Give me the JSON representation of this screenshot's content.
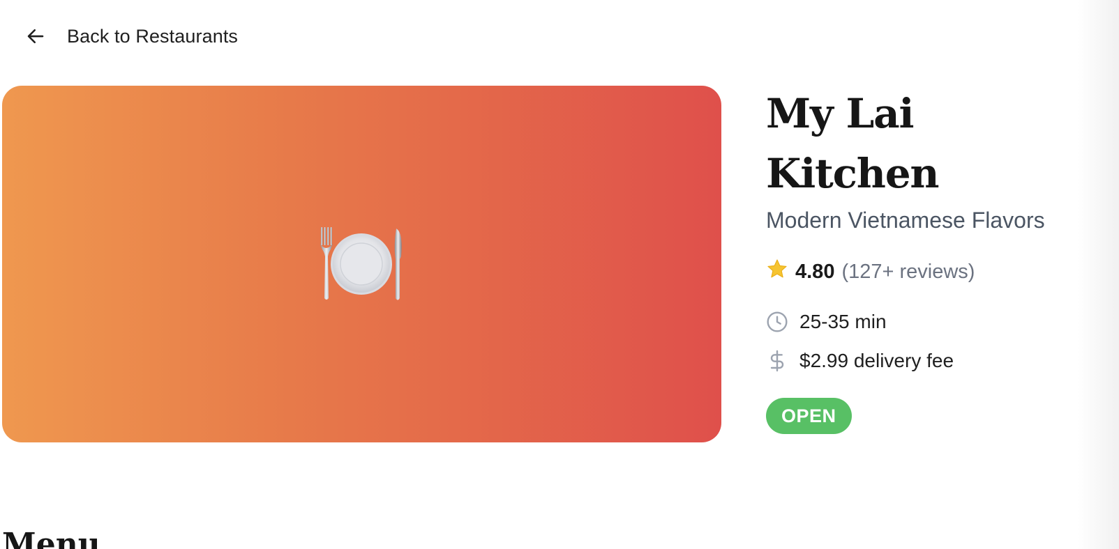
{
  "nav": {
    "back_label": "Back to Restaurants",
    "back_icon": "arrow-left-icon"
  },
  "hero": {
    "icon": "fork-knife-plate-icon",
    "gradient_colors": [
      "#ef984f",
      "#e77a4a",
      "#df504b"
    ]
  },
  "restaurant": {
    "name": "My Lai Kitchen",
    "tagline": "Modern Vietnamese Flavors",
    "rating": {
      "icon": "star-icon",
      "value": "4.80",
      "count": "(127+ reviews)"
    },
    "delivery_time": {
      "icon": "clock-icon",
      "text": "25-35 min"
    },
    "delivery_fee": {
      "icon": "dollar-icon",
      "text": "$2.99 delivery fee"
    },
    "status": {
      "label": "OPEN",
      "color": "#58c065"
    }
  },
  "menu": {
    "heading": "Menu"
  }
}
